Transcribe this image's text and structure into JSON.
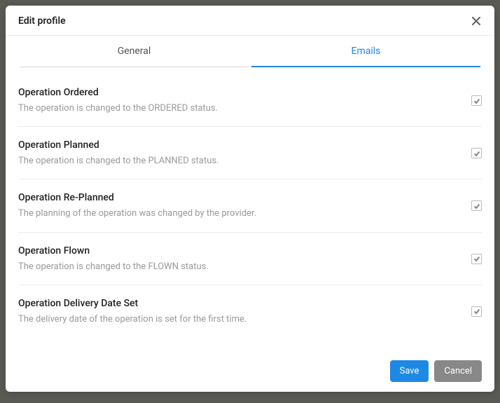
{
  "modal": {
    "title": "Edit profile"
  },
  "tabs": {
    "general": "General",
    "emails": "Emails"
  },
  "settings": [
    {
      "label": "Operation Ordered",
      "desc": "The operation is changed to the ORDERED status.",
      "checked": true
    },
    {
      "label": "Operation Planned",
      "desc": "The operation is changed to the PLANNED status.",
      "checked": true
    },
    {
      "label": "Operation Re-Planned",
      "desc": "The planning of the operation was changed by the provider.",
      "checked": true
    },
    {
      "label": "Operation Flown",
      "desc": "The operation is changed to the FLOWN status.",
      "checked": true
    },
    {
      "label": "Operation Delivery Date Set",
      "desc": "The delivery date of the operation is set for the first time.",
      "checked": true
    }
  ],
  "footer": {
    "save": "Save",
    "cancel": "Cancel"
  }
}
